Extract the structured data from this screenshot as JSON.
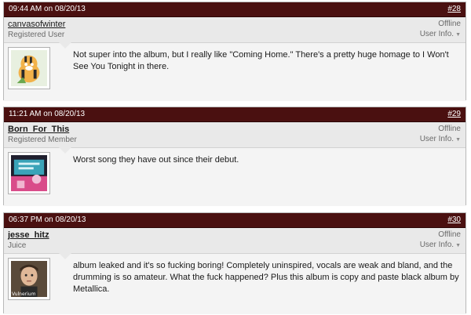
{
  "posts": [
    {
      "date": "09:44 AM on 08/20/13",
      "number": "#28",
      "username": "canvasofwinter",
      "user_title": "Registered User",
      "status": "Offline",
      "user_info": "User Info.",
      "message": "Not super into the album, but I really like \"Coming Home.\" There's a pretty huge homage to I Won't See You Tonight in there."
    },
    {
      "date": "11:21 AM on 08/20/13",
      "number": "#29",
      "username": "Born_For_This",
      "user_title": "Registered Member",
      "status": "Offline",
      "user_info": "User Info.",
      "message": "Worst song they have out since their debut."
    },
    {
      "date": "06:37 PM on 08/20/13",
      "number": "#30",
      "username": "jesse_hitz",
      "user_title": "Juice",
      "status": "Offline",
      "user_info": "User Info.",
      "message": "album leaked and it's so fucking boring! Completely uninspired, vocals are weak and bland, and the drumming is so amateur. What the fuck happened? Plus this album is copy and paste black album by Metallica.",
      "avatar_caption": "Vulnerium"
    }
  ],
  "colors": {
    "header_bg": "#4a1010",
    "user_bar_bg": "#e9e9e9",
    "body_bg": "#f4f4f4"
  }
}
